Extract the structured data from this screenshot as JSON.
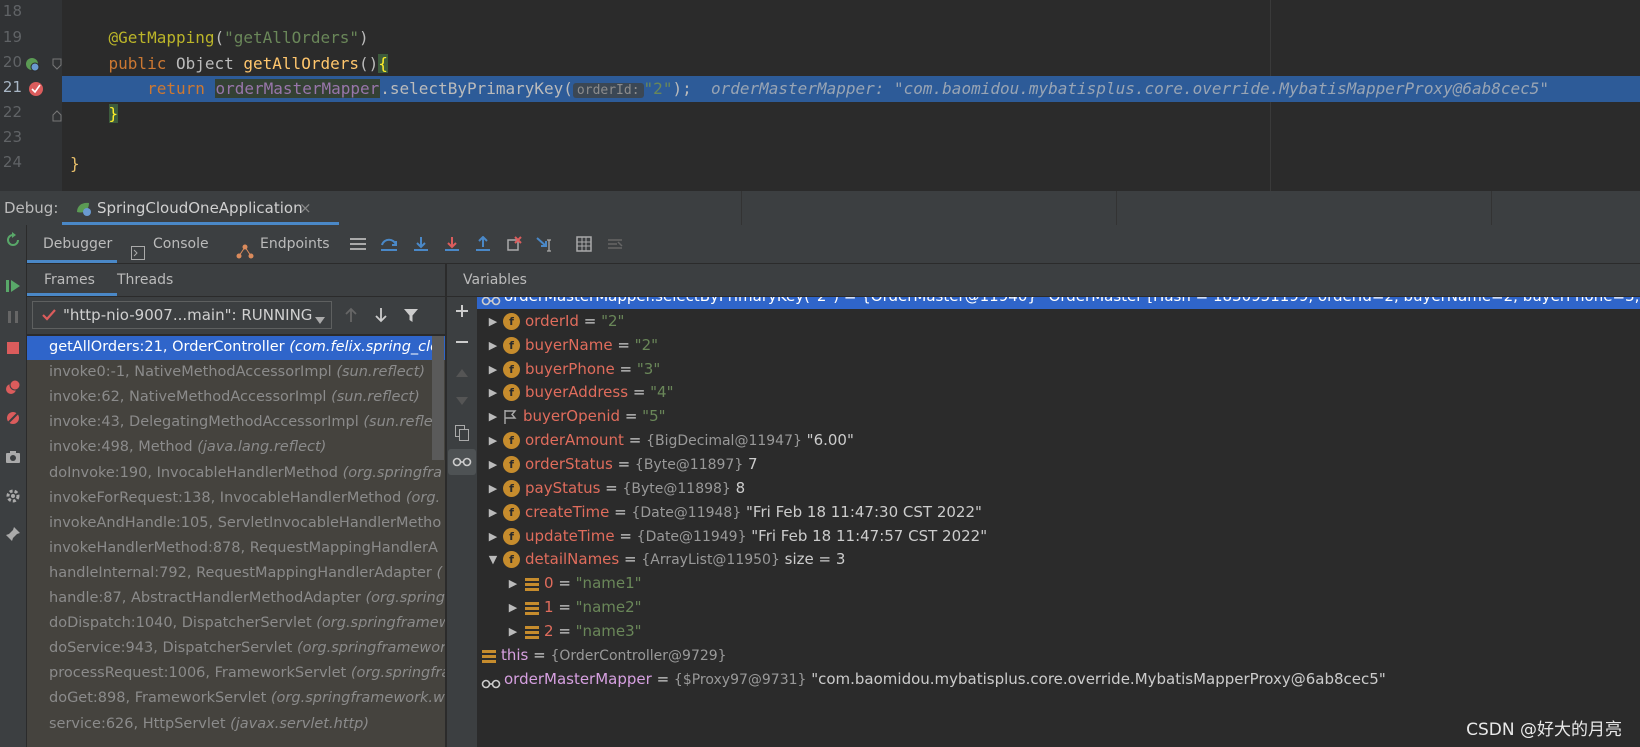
{
  "editor": {
    "lines": [
      {
        "num": "18"
      },
      {
        "num": "19",
        "annotation": "@GetMapping",
        "paren_open": "(",
        "mapping": "\"getAllOrders\"",
        "paren_close": ")"
      },
      {
        "num": "20",
        "kw_public": "public",
        "type": " Object ",
        "method": "getAllOrders",
        "parens": "()",
        "brace": "{"
      },
      {
        "num": "21",
        "kw_return": "return",
        "field": "orderMasterMapper",
        "call": ".selectByPrimaryKey(",
        "hint": "orderId:",
        "arg": "\"2\"",
        "close": ");",
        "inline_value": "orderMasterMapper: \"com.baomidou.mybatisplus.core.override.MybatisMapperProxy@6ab8cec5\""
      },
      {
        "num": "22",
        "brace": "}"
      },
      {
        "num": "23"
      },
      {
        "num": "24",
        "brace": "}"
      }
    ]
  },
  "debug_bar": {
    "label": "Debug:",
    "tab_title": "SpringCloudOneApplication",
    "tab_close": "×"
  },
  "toolbar": {
    "debugger": "Debugger",
    "console": "Console",
    "endpoints": "Endpoints"
  },
  "frames_panel": {
    "tab_frames": "Frames",
    "tab_threads": "Threads",
    "thread_select": "\"http-nio-9007...main\": RUNNING",
    "frames": [
      {
        "method": "getAllOrders:21, OrderController ",
        "pkg": "(com.felix.spring_clo"
      },
      {
        "method": "invoke0:-1, NativeMethodAccessorImpl ",
        "pkg": "(sun.reflect)"
      },
      {
        "method": "invoke:62, NativeMethodAccessorImpl ",
        "pkg": "(sun.reflect)"
      },
      {
        "method": "invoke:43, DelegatingMethodAccessorImpl ",
        "pkg": "(sun.reflec"
      },
      {
        "method": "invoke:498, Method ",
        "pkg": "(java.lang.reflect)"
      },
      {
        "method": "doInvoke:190, InvocableHandlerMethod ",
        "pkg": "(org.springfra"
      },
      {
        "method": "invokeForRequest:138, InvocableHandlerMethod ",
        "pkg": "(org."
      },
      {
        "method": "invokeAndHandle:105, ServletInvocableHandlerMetho",
        "pkg": ""
      },
      {
        "method": "invokeHandlerMethod:878, RequestMappingHandlerA",
        "pkg": ""
      },
      {
        "method": "handleInternal:792, RequestMappingHandlerAdapter ",
        "pkg": "("
      },
      {
        "method": "handle:87, AbstractHandlerMethodAdapter ",
        "pkg": "(org.spring"
      },
      {
        "method": "doDispatch:1040, DispatcherServlet ",
        "pkg": "(org.springframew"
      },
      {
        "method": "doService:943, DispatcherServlet ",
        "pkg": "(org.springframewor"
      },
      {
        "method": "processRequest:1006, FrameworkServlet ",
        "pkg": "(org.springfra"
      },
      {
        "method": "doGet:898, FrameworkServlet ",
        "pkg": "(org.springframework.w"
      },
      {
        "method": "service:626, HttpServlet ",
        "pkg": "(javax.servlet.http)"
      }
    ]
  },
  "variables_panel": {
    "title": "Variables",
    "rows": [
      {
        "name": "orderMasterMapper.selectByPrimaryKey(\"2\")",
        "type": "",
        "value": " = {OrderMaster@11940} \"OrderMaster [Hash = 1830951199, orderId=2, buyerName=2, buyerPhone=3, buy"
      },
      {
        "name": "orderId",
        "type": "",
        "value": "\"2\""
      },
      {
        "name": "buyerName",
        "type": "",
        "value": "\"2\""
      },
      {
        "name": "buyerPhone",
        "type": "",
        "value": "\"3\""
      },
      {
        "name": "buyerAddress",
        "type": "",
        "value": "\"4\""
      },
      {
        "name": "buyerOpenid",
        "type": "",
        "value": "\"5\""
      },
      {
        "name": "orderAmount",
        "type": "{BigDecimal@11947}",
        "value": "\"6.00\""
      },
      {
        "name": "orderStatus",
        "type": "{Byte@11897}",
        "value": "7"
      },
      {
        "name": "payStatus",
        "type": "{Byte@11898}",
        "value": "8"
      },
      {
        "name": "createTime",
        "type": "{Date@11948}",
        "value": "\"Fri Feb 18 11:47:30 CST 2022\""
      },
      {
        "name": "updateTime",
        "type": "{Date@11949}",
        "value": "\"Fri Feb 18 11:47:57 CST 2022\""
      },
      {
        "name": "detailNames",
        "type": "{ArrayList@11950}",
        "value": "size = 3"
      },
      {
        "name": "0",
        "type": "",
        "value": "\"name1\""
      },
      {
        "name": "1",
        "type": "",
        "value": "\"name2\""
      },
      {
        "name": "2",
        "type": "",
        "value": "\"name3\""
      },
      {
        "name": "this",
        "type": "{OrderController@9729}",
        "value": ""
      },
      {
        "name": "orderMasterMapper",
        "type": "{$Proxy97@9731}",
        "value": "\"com.baomidou.mybatisplus.core.override.MybatisMapperProxy@6ab8cec5\""
      }
    ]
  },
  "watermark": "CSDN @好大的月亮",
  "colors": {
    "selection": "#2f65ca",
    "editor_bg": "#2b2b2b",
    "panel_bg": "#3c3f41",
    "field_icon": "#c68c2d",
    "string": "#6a8759",
    "keyword": "#cc7832"
  }
}
